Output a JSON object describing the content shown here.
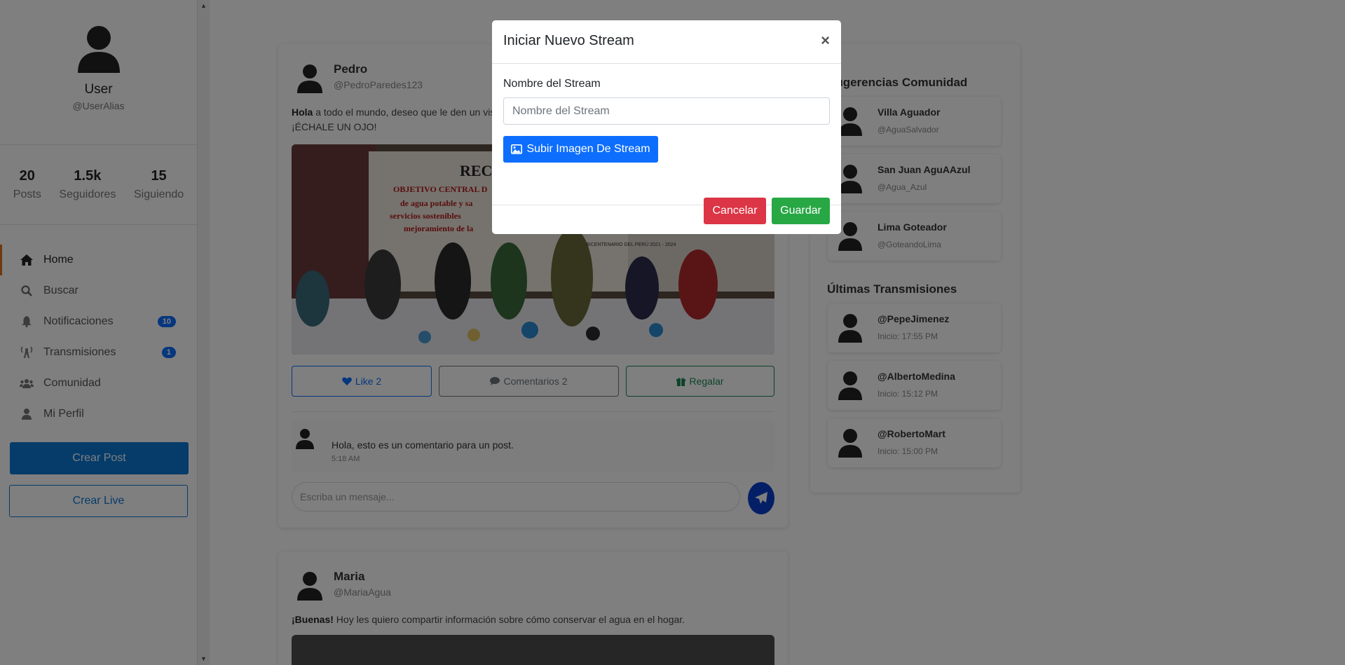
{
  "sidebar": {
    "user": {
      "name": "User",
      "alias": "@UserAlias"
    },
    "stats": [
      {
        "value": "20",
        "label": "Posts"
      },
      {
        "value": "1.5k",
        "label": "Seguidores"
      },
      {
        "value": "15",
        "label": "Siguiendo"
      }
    ],
    "nav": [
      {
        "label": "Home",
        "icon": "home-icon",
        "active": true
      },
      {
        "label": "Buscar",
        "icon": "search-icon"
      },
      {
        "label": "Notificaciones",
        "icon": "bell-icon",
        "badge": "10"
      },
      {
        "label": "Transmisiones",
        "icon": "broadcast-tower-icon",
        "badge": "1"
      },
      {
        "label": "Comunidad",
        "icon": "users-icon"
      },
      {
        "label": "Mi Perfil",
        "icon": "user-icon"
      }
    ],
    "create_post": "Crear Post",
    "create_live": "Crear Live"
  },
  "post1": {
    "name": "Pedro",
    "alias": "@PedroParedes123",
    "text_bold": "Hola",
    "text": " a todo el mundo, deseo que le den un vist",
    "text2": "¡ÉCHALE UN OJO!",
    "image_text": {
      "heading": "REC",
      "line1": "OBJETIVO CENTRAL D",
      "line2": "de agua potable y sa",
      "line3": "servicios sostenibles",
      "line4": "mejoramiento de la",
      "bicentenario": "BICENTENARIO DEL PERÚ 2021 - 2024"
    },
    "like": "Like 2",
    "comments": "Comentarios 2",
    "gift": "Regalar",
    "comment": {
      "text": "Hola, esto es un comentario para un post.",
      "time": "5:18 AM"
    },
    "input_placeholder": "Escriba un mensaje..."
  },
  "post2": {
    "name": "Maria",
    "alias": "@MariaAgua",
    "text_bold": "¡Buenas!",
    "text": " Hoy les quiero compartir información sobre cómo conservar el agua en el hogar."
  },
  "right_panel": {
    "suggestions_title": "Sugerencias Comunidad",
    "suggestions": [
      {
        "name": "Villa Aguador",
        "sub": "@AguaSalvador"
      },
      {
        "name": "San Juan AguAAzul",
        "sub": "@Agua_Azul"
      },
      {
        "name": "Lima Goteador",
        "sub": "@GoteandoLima"
      }
    ],
    "streams_title": "Últimas Transmisiones",
    "streams": [
      {
        "name": "@PepeJimenez",
        "sub": "Inicio: 17:55 PM"
      },
      {
        "name": "@AlbertoMedina",
        "sub": "Inicio: 15:12 PM"
      },
      {
        "name": "@RobertoMart",
        "sub": "Inicio: 15:00 PM"
      }
    ]
  },
  "modal": {
    "title": "Iniciar Nuevo Stream",
    "close": "×",
    "field_label": "Nombre del Stream",
    "field_placeholder": "Nombre del Stream",
    "upload": "Subir Imagen De Stream",
    "cancel": "Cancelar",
    "save": "Guardar"
  },
  "colors": {
    "primary": "#0d6efd",
    "danger": "#dc3545",
    "success": "#28a745",
    "accent": "#e07020"
  }
}
